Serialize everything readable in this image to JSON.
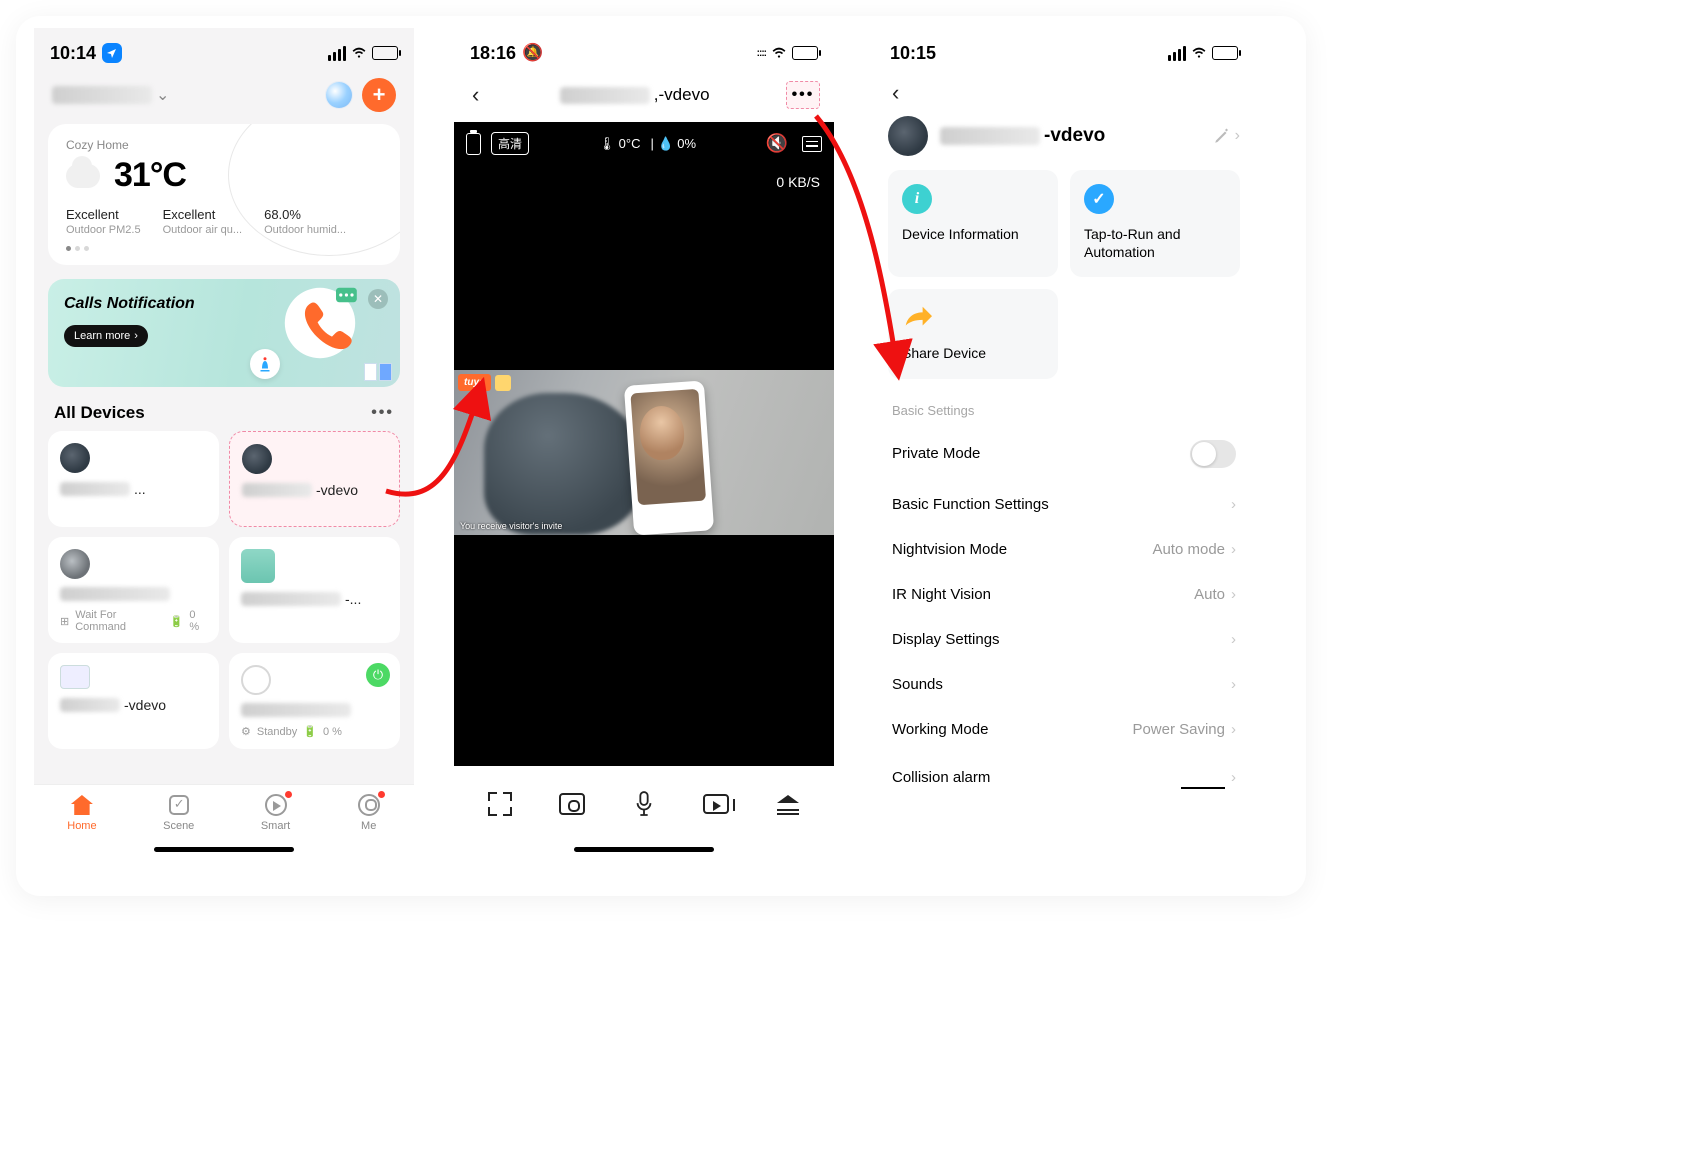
{
  "screen1": {
    "status_time": "10:14",
    "room_name_placeholder": "",
    "weather": {
      "title": "Cozy Home",
      "temp": "31°C",
      "stats": [
        {
          "value": "Excellent",
          "label": "Outdoor PM2.5"
        },
        {
          "value": "Excellent",
          "label": "Outdoor air qu..."
        },
        {
          "value": "68.0%",
          "label": "Outdoor humid..."
        }
      ]
    },
    "banner": {
      "title": "Calls Notification",
      "cta": "Learn more"
    },
    "all_devices_title": "All Devices",
    "devices": {
      "d0_suffix": "...",
      "d1_suffix": "-vdevo",
      "d2_sub1": "Wait For Command",
      "d2_sub2": "0 %",
      "d3_suffix": "-...",
      "d4_suffix": "-vdevo",
      "d5_sub1": "Standby",
      "d5_sub2": "0 %"
    },
    "tabs": {
      "home": "Home",
      "scene": "Scene",
      "smart": "Smart",
      "me": "Me"
    }
  },
  "screen2": {
    "status_time": "18:16",
    "title_suffix": ",-vdevo",
    "hd_label": "高清",
    "temp": "0°C",
    "humidity": "0%",
    "kbs": "0 KB/S",
    "tuya_badge": "tuya",
    "feed_caption": "You receive visitor's invite"
  },
  "screen3": {
    "status_time": "10:15",
    "dev_suffix": "-vdevo",
    "tiles": {
      "info": "Device Information",
      "auto": "Tap-to-Run and Automation",
      "share": "Share Device"
    },
    "basic_header": "Basic Settings",
    "rows": {
      "private": "Private Mode",
      "bfs": "Basic Function Settings",
      "nv": "Nightvision Mode",
      "nv_v": "Auto mode",
      "ir": "IR Night Vision",
      "ir_v": "Auto",
      "disp": "Display Settings",
      "sound": "Sounds",
      "work": "Working Mode",
      "work_v": "Power Saving",
      "coll": "Collision alarm"
    }
  }
}
